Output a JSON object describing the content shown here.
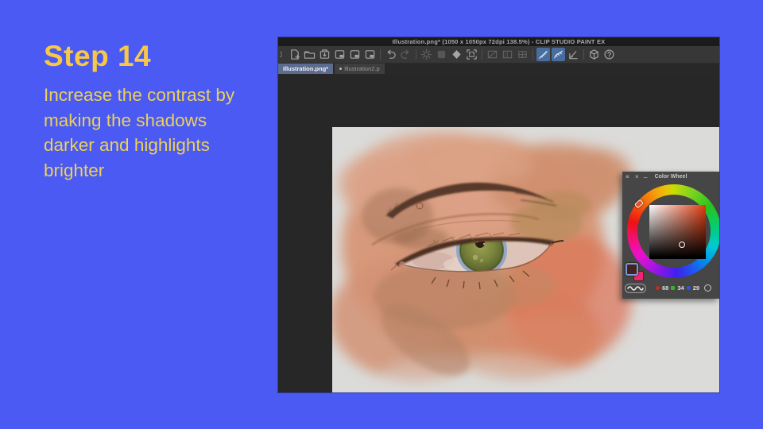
{
  "slide": {
    "background_color": "#4a5af2",
    "heading": "Step 14",
    "heading_color": "#f7c845",
    "body_color": "#ecd05c",
    "body_lines": [
      "Increase the contrast by",
      "making the shadows",
      "darker and highlights",
      "brighter"
    ]
  },
  "app_window": {
    "title_bar": {
      "title": "Illustration.png* (1050 x 1050px 72dpi 138.5%)  - CLIP STUDIO PAINT EX"
    },
    "toolbar": {
      "active_bg": "#4a6da0",
      "items": [
        {
          "icon": "partial-tool",
          "type": "button",
          "state": "normal"
        },
        {
          "icon": "new-file",
          "type": "button",
          "state": "normal"
        },
        {
          "icon": "open-file",
          "type": "button",
          "state": "normal"
        },
        {
          "icon": "save-file",
          "type": "button",
          "state": "normal"
        },
        {
          "icon": "export-single",
          "type": "button",
          "state": "normal"
        },
        {
          "icon": "export-batch",
          "type": "button",
          "state": "normal"
        },
        {
          "icon": "export-webtoon",
          "type": "button",
          "state": "normal"
        },
        {
          "icon": "divider",
          "type": "divider"
        },
        {
          "icon": "undo",
          "type": "button",
          "state": "normal"
        },
        {
          "icon": "redo",
          "type": "button",
          "state": "disabled"
        },
        {
          "icon": "divider",
          "type": "divider"
        },
        {
          "icon": "filter",
          "type": "button",
          "state": "disabled"
        },
        {
          "icon": "tone",
          "type": "button",
          "state": "disabled"
        },
        {
          "icon": "fill",
          "type": "button",
          "state": "normal"
        },
        {
          "icon": "frame",
          "type": "button",
          "state": "normal"
        },
        {
          "icon": "divider",
          "type": "divider"
        },
        {
          "icon": "select-layer",
          "type": "button",
          "state": "disabled"
        },
        {
          "icon": "gradient",
          "type": "button",
          "state": "disabled"
        },
        {
          "icon": "mesh",
          "type": "button",
          "state": "disabled"
        },
        {
          "icon": "divider",
          "type": "divider"
        },
        {
          "icon": "snap-ruler",
          "type": "button",
          "state": "active"
        },
        {
          "icon": "snap-special-ruler",
          "type": "button",
          "state": "active"
        },
        {
          "icon": "snap-grid",
          "type": "button",
          "state": "normal"
        },
        {
          "icon": "divider",
          "type": "divider"
        },
        {
          "icon": "material",
          "type": "button",
          "state": "normal"
        },
        {
          "icon": "help",
          "type": "button",
          "state": "normal"
        }
      ]
    },
    "tabs": [
      {
        "label": "Illustration.png*",
        "active": true
      },
      {
        "label": "Illustration2.p",
        "active": false
      }
    ],
    "color_wheel_panel": {
      "title": "Color Wheel",
      "window_icons": {
        "menu": "≡",
        "close": "×",
        "minimize": "_"
      },
      "hue_marker_color": "#e8501e",
      "main_color": "#44221d",
      "sub_color": "#f2246d",
      "rgb_values": [
        {
          "channel": "red",
          "value": "68",
          "dot_color": "#cc2a14"
        },
        {
          "channel": "green",
          "value": "34",
          "dot_color": "#3fae2a"
        },
        {
          "channel": "blue",
          "value": "29",
          "dot_color": "#2f55e8"
        }
      ]
    }
  }
}
